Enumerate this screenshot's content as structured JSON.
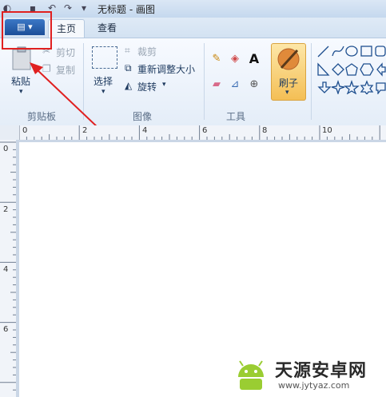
{
  "window": {
    "title": "无标题 - 画图"
  },
  "tabs": {
    "file_label": "▾",
    "home": "主页",
    "view": "查看"
  },
  "clipboard": {
    "paste": "粘贴",
    "cut": "剪切",
    "copy": "复制",
    "group": "剪贴板"
  },
  "image": {
    "select": "选择",
    "crop": "裁剪",
    "resize": "重新调整大小",
    "rotate": "旋转",
    "group": "图像"
  },
  "tools": {
    "text_tool": "A",
    "group": "工具"
  },
  "brushes": {
    "label": "刷子"
  },
  "ruler": {
    "h_labels": [
      "0",
      "2",
      "4",
      "6",
      "8",
      "10"
    ],
    "v_labels": [
      "0",
      "2",
      "4",
      "6"
    ]
  },
  "watermark": {
    "brand": "天源安卓网",
    "url": "www.jytyaz.com"
  },
  "colors": {
    "highlight": "#e02020",
    "accent": "#1b4e98",
    "brush_bg": "#f7c96a"
  }
}
